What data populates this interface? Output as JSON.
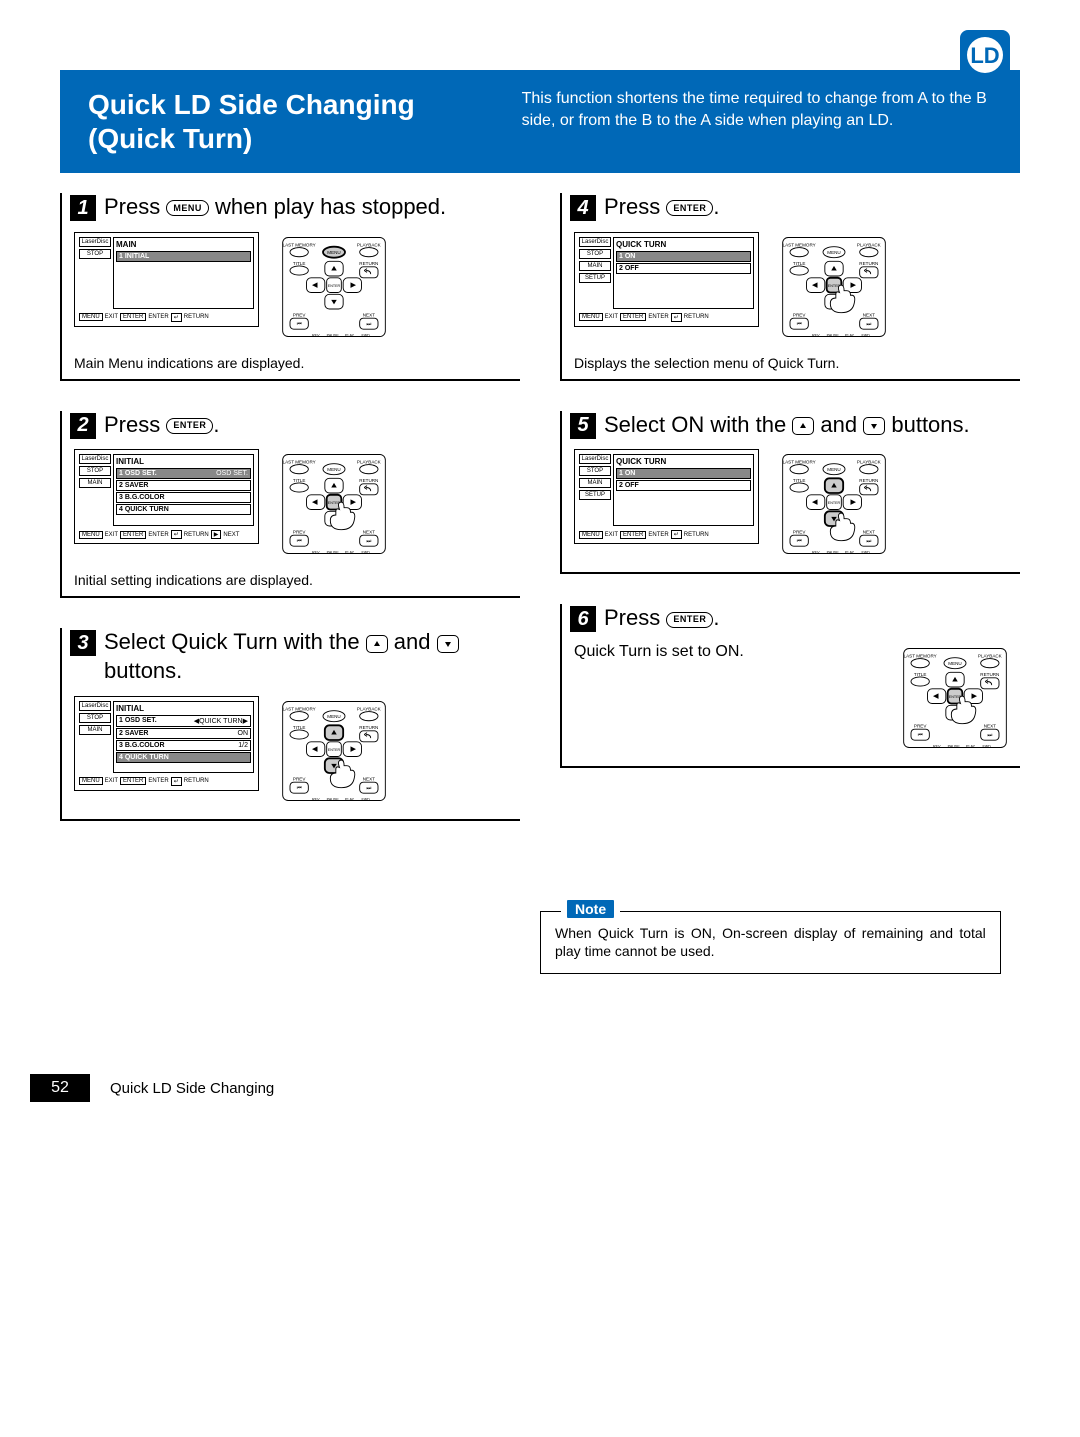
{
  "logo_text": "LD",
  "header": {
    "title_line1": "Quick LD Side Changing",
    "title_line2": "(Quick Turn)",
    "description": "This function shortens the time required to change from A to the B side, or from the B to the A side when playing an LD."
  },
  "buttons": {
    "menu_label": "MENU",
    "enter_label": "ENTER"
  },
  "steps": [
    {
      "number": "1",
      "text_before": "Press ",
      "button": "menu",
      "text_after": " when play has stopped.",
      "osd": {
        "side_labels": [
          "LaserDisc",
          "STOP"
        ],
        "title": "MAIN",
        "rows": [
          {
            "label": "1 INITIAL",
            "hl": true
          }
        ],
        "footer": [
          "MENU",
          "EXIT",
          "ENTER",
          "ENTER",
          "↵",
          "RETURN"
        ]
      },
      "caption": "Main Menu indications are displayed."
    },
    {
      "number": "2",
      "text_before": "Press ",
      "button": "enter",
      "text_after": ".",
      "osd": {
        "side_labels": [
          "LaserDisc",
          "STOP",
          "MAIN"
        ],
        "title": "INITIAL",
        "rows": [
          {
            "label": "1 OSD SET.",
            "right": "OSD SET.",
            "hl": true
          },
          {
            "label": "2 SAVER"
          },
          {
            "label": "3 B.G.COLOR"
          },
          {
            "label": "4 QUICK TURN"
          }
        ],
        "footer": [
          "MENU",
          "EXIT",
          "ENTER",
          "ENTER",
          "↵",
          "RETURN",
          "▶",
          "NEXT"
        ]
      },
      "caption": "Initial setting indications are displayed."
    },
    {
      "number": "3",
      "text_before": "Select Quick Turn with the ",
      "button": "updown",
      "text_after": " buttons.",
      "osd": {
        "side_labels": [
          "LaserDisc",
          "STOP",
          "MAIN"
        ],
        "title": "INITIAL",
        "rows": [
          {
            "label": "1 OSD SET.",
            "right": "◀QUICK TURN▶"
          },
          {
            "label": "2 SAVER",
            "right": "ON"
          },
          {
            "label": "3 B.G.COLOR",
            "right": "1/2"
          },
          {
            "label": "4 QUICK TURN",
            "hl": true
          }
        ],
        "footer": [
          "MENU",
          "EXIT",
          "ENTER",
          "ENTER",
          "↵",
          "RETURN"
        ]
      },
      "caption": ""
    },
    {
      "number": "4",
      "text_before": "Press ",
      "button": "enter",
      "text_after": ".",
      "osd": {
        "side_labels": [
          "LaserDisc",
          "STOP",
          "MAIN",
          "SETUP"
        ],
        "title": "QUICK TURN",
        "rows": [
          {
            "label": "1 ON",
            "hl": true
          },
          {
            "label": "2 OFF"
          }
        ],
        "footer": [
          "MENU",
          "EXIT",
          "ENTER",
          "ENTER",
          "↵",
          "RETURN"
        ]
      },
      "caption": "Displays the selection menu of Quick Turn."
    },
    {
      "number": "5",
      "text_before": "Select ON with the ",
      "button": "updown",
      "text_after": " buttons.",
      "osd": {
        "side_labels": [
          "LaserDisc",
          "STOP",
          "MAIN",
          "SETUP"
        ],
        "title": "QUICK TURN",
        "rows": [
          {
            "label": "1 ON",
            "hl": true
          },
          {
            "label": "2 OFF"
          }
        ],
        "footer": [
          "MENU",
          "EXIT",
          "ENTER",
          "ENTER",
          "↵",
          "RETURN"
        ]
      },
      "caption": ""
    },
    {
      "number": "6",
      "text_before": "Press ",
      "button": "enter",
      "text_after": ".",
      "osd": null,
      "caption": "Quick Turn is set to ON."
    }
  ],
  "note": {
    "badge": "Note",
    "text": "When Quick Turn is ON, On-screen display of remaining and total play time cannot be used."
  },
  "footer": {
    "page_number": "52",
    "section": "Quick LD Side Changing"
  }
}
